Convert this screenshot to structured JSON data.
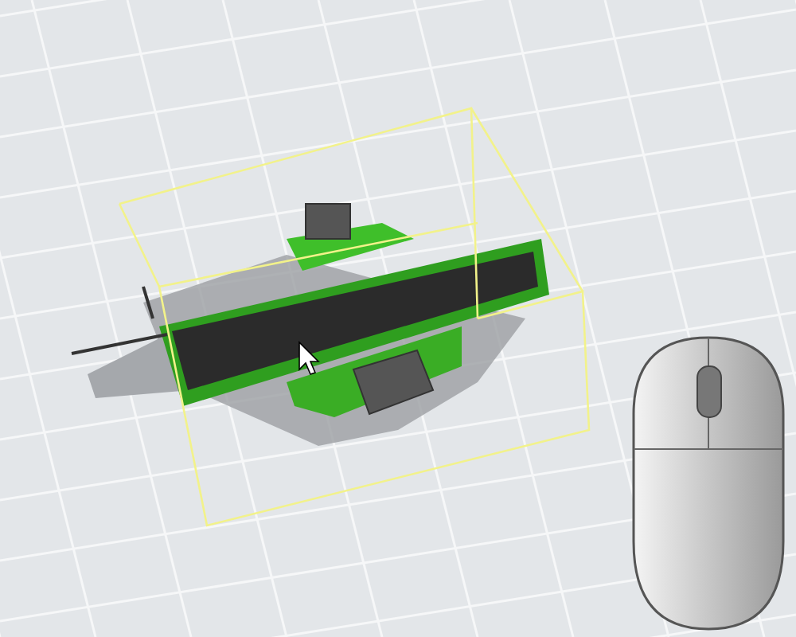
{
  "viewport": {
    "objects": [
      {
        "kind": "conveyor",
        "selected": true
      }
    ]
  }
}
